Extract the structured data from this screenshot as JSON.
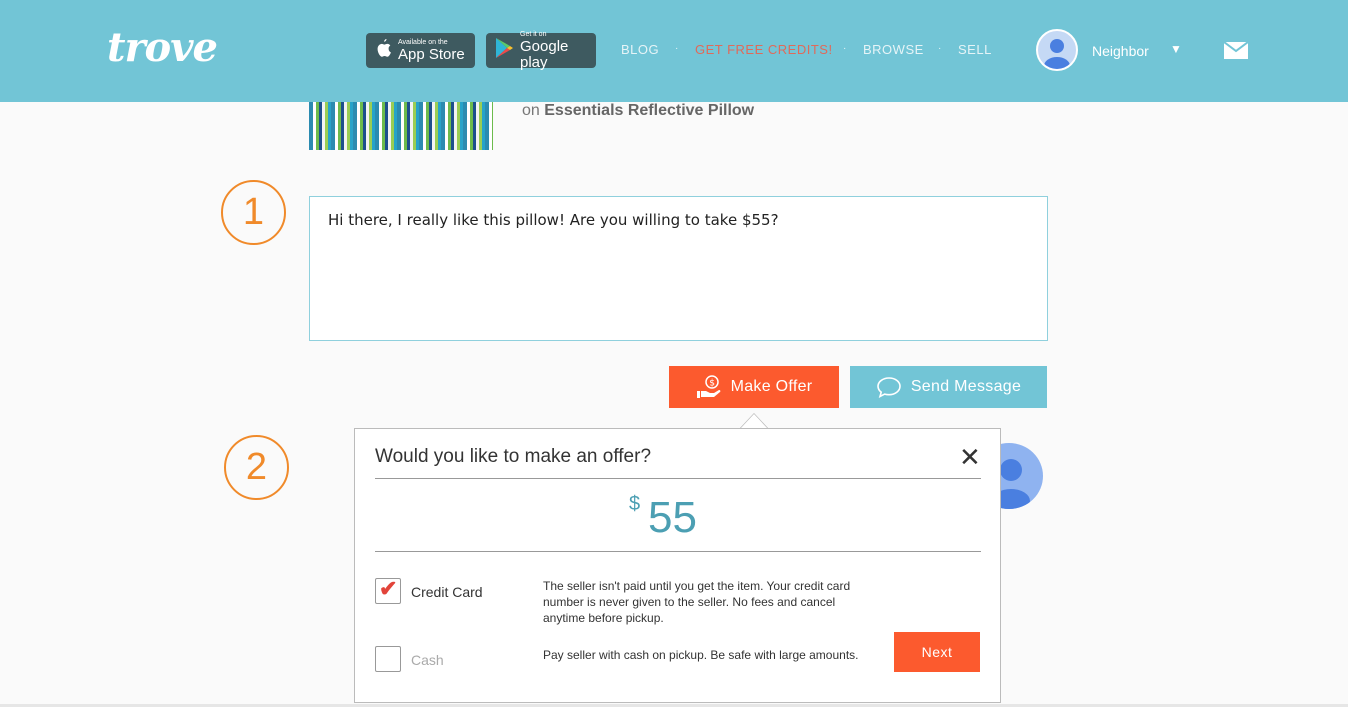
{
  "header": {
    "logo": "trove",
    "app_store": {
      "small": "Available on the",
      "big": "App Store"
    },
    "google_play": {
      "small": "Get it on",
      "big": "Google play"
    },
    "nav": {
      "blog": "BLOG",
      "credits": "GET FREE CREDITS!",
      "browse": "BROWSE",
      "sell": "SELL",
      "separator": "·"
    },
    "user": {
      "name": "Neighbor",
      "caret": "▼"
    },
    "icons": {
      "mail": "mail-icon",
      "avatar": "user-avatar-icon"
    }
  },
  "listing": {
    "on_prefix": "on",
    "item_name": "Essentials Reflective Pillow"
  },
  "steps": {
    "one": "1",
    "two": "2"
  },
  "message": {
    "text": "Hi there, I really like this pillow! Are you willing to take $55?"
  },
  "actions": {
    "make_offer": "Make Offer",
    "send_message": "Send Message"
  },
  "offer_popup": {
    "title": "Would you like to make an offer?",
    "close": "✕",
    "currency": "$",
    "amount": "55",
    "options": [
      {
        "label": "Credit Card",
        "checked": true,
        "description": "The seller isn't paid until you get the item. Your credit card number is never given to the seller. No fees and cancel anytime before pickup."
      },
      {
        "label": "Cash",
        "checked": false,
        "description": "Pay seller with cash on pickup. Be safe with large amounts."
      }
    ],
    "next": "Next"
  },
  "colors": {
    "header_bg": "#72c5d6",
    "accent_orange": "#fc5a2e",
    "step_orange": "#f08a2a",
    "amount_teal": "#4c9fb3",
    "credits_red": "#e06a5a"
  }
}
